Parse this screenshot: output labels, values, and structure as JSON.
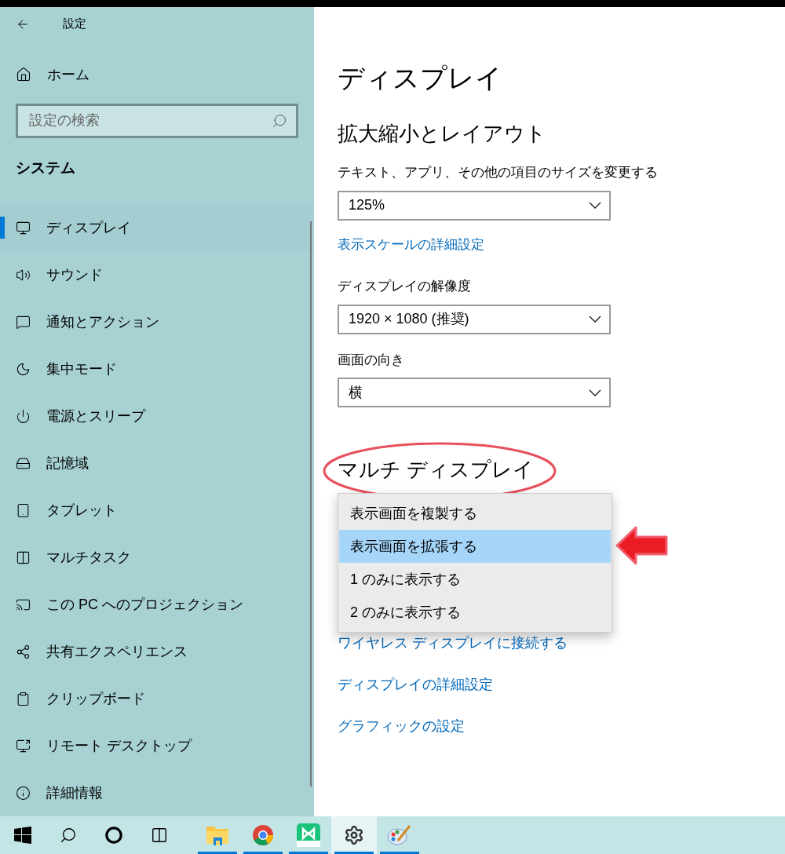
{
  "window": {
    "title": "設定"
  },
  "sidebar": {
    "home": "ホーム",
    "search": {
      "placeholder": "設定の検索"
    },
    "section": "システム",
    "items": [
      {
        "label": "ディスプレイ",
        "selected": true
      },
      {
        "label": "サウンド",
        "selected": false
      },
      {
        "label": "通知とアクション",
        "selected": false
      },
      {
        "label": "集中モード",
        "selected": false
      },
      {
        "label": "電源とスリープ",
        "selected": false
      },
      {
        "label": "記憶域",
        "selected": false
      },
      {
        "label": "タブレット",
        "selected": false
      },
      {
        "label": "マルチタスク",
        "selected": false
      },
      {
        "label": "この PC へのプロジェクション",
        "selected": false
      },
      {
        "label": "共有エクスペリエンス",
        "selected": false
      },
      {
        "label": "クリップボード",
        "selected": false
      },
      {
        "label": "リモート デスクトップ",
        "selected": false
      },
      {
        "label": "詳細情報",
        "selected": false
      }
    ]
  },
  "main": {
    "title": "ディスプレイ",
    "section": "拡大縮小とレイアウト",
    "scale": {
      "label": "テキスト、アプリ、その他の項目のサイズを変更する",
      "value": "125%"
    },
    "scale_link": "表示スケールの詳細設定",
    "resolution": {
      "label": "ディスプレイの解像度",
      "value": "1920 × 1080 (推奨)"
    },
    "orientation": {
      "label": "画面の向き",
      "value": "横"
    },
    "multi_display": {
      "heading": "マルチ ディスプレイ",
      "options": [
        {
          "label": "表示画面を複製する",
          "selected": false
        },
        {
          "label": "表示画面を拡張する",
          "selected": true
        },
        {
          "label": "1 のみに表示する",
          "selected": false
        },
        {
          "label": "2 のみに表示する",
          "selected": false
        }
      ]
    },
    "links": [
      "ワイヤレス ディスプレイに接続する",
      "ディスプレイの詳細設定",
      "グラフィックの設定"
    ]
  },
  "taskbar": {
    "items": [
      {
        "running": false,
        "active": false
      },
      {
        "running": false,
        "active": false
      },
      {
        "running": false,
        "active": false
      },
      {
        "running": false,
        "active": false
      },
      {
        "running": true,
        "active": false
      },
      {
        "running": true,
        "active": false
      },
      {
        "running": true,
        "active": false
      },
      {
        "running": true,
        "active": true
      },
      {
        "running": true,
        "active": false
      }
    ]
  }
}
